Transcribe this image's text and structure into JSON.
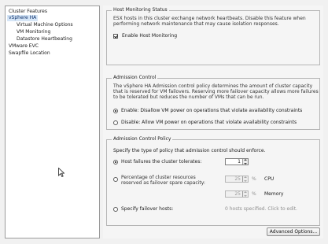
{
  "nav": {
    "items": [
      {
        "label": "Cluster Features"
      },
      {
        "label": "vSphere HA"
      },
      {
        "label": "Virtual Machine Options"
      },
      {
        "label": "VM Monitoring"
      },
      {
        "label": "Datastore Heartbeating"
      },
      {
        "label": "VMware EVC"
      },
      {
        "label": "Swapfile Location"
      }
    ]
  },
  "host_monitoring": {
    "legend": "Host Monitoring Status",
    "description": "ESX hosts in this cluster exchange network heartbeats. Disable this feature when performing network maintenance that may cause isolation responses.",
    "enable_label": "Enable Host Monitoring",
    "enabled": true
  },
  "admission_control": {
    "legend": "Admission Control",
    "description": "The vSphere HA Admission control policy determines the amount of cluster capacity that is reserved for VM failovers. Reserving more failover capacity allows more failures to be tolerated but reduces the number of VMs that can be run.",
    "enable_label": "Enable: Disallow VM power on operations that violate availability constraints",
    "disable_label": "Disable: Allow VM power on operations that violate availability constraints",
    "selected": "enable"
  },
  "policy": {
    "legend": "Admission Control Policy",
    "intro": "Specify the type of policy that admission control should enforce.",
    "host_failures_label": "Host failures the cluster tolerates:",
    "host_failures_value": "1",
    "percentage_label": "Percentage of cluster resources reserved as failover spare capacity:",
    "cpu_value": "25",
    "memory_value": "25",
    "percent_symbol": "%",
    "cpu_label": "CPU",
    "memory_label": "Memory",
    "failover_hosts_label": "Specify failover hosts:",
    "failover_hosts_status": "0 hosts specified. Click to edit.",
    "selected": "host_failures"
  },
  "advanced_button": "Advanced Options..."
}
